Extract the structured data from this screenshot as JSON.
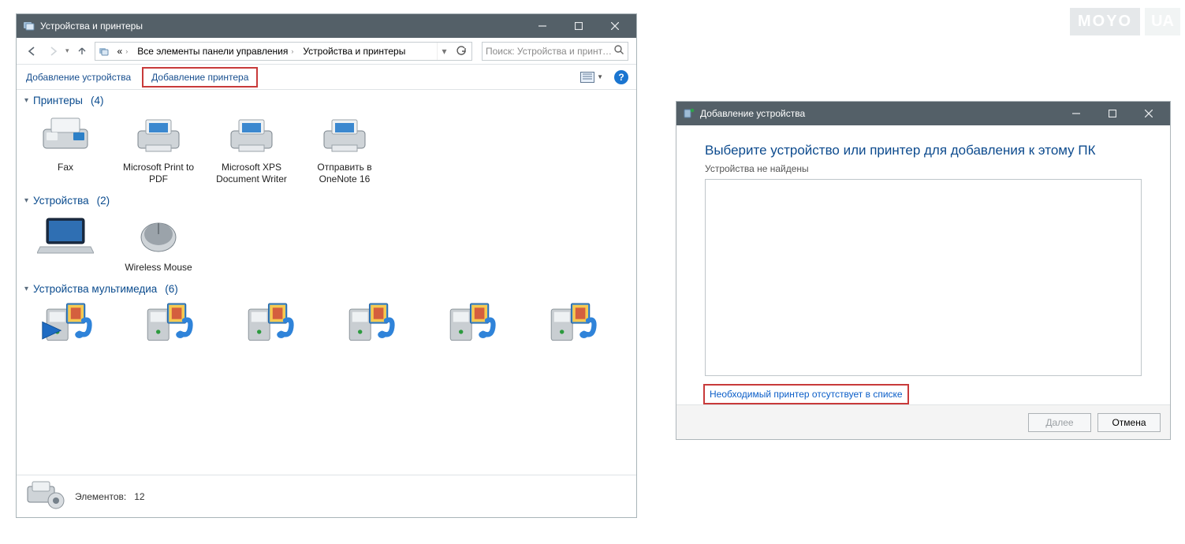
{
  "watermark": {
    "moyo": "MOYO",
    "ua": "UA"
  },
  "window": {
    "title": "Устройства и принтеры",
    "breadcrumb": {
      "ellipsis": "«",
      "seg1": "Все элементы панели управления",
      "seg2": "Устройства и принтеры"
    },
    "search_placeholder": "Поиск: Устройства и принте...",
    "commands": {
      "add_device": "Добавление устройства",
      "add_printer": "Добавление принтера"
    },
    "groups": {
      "printers": {
        "title": "Принтеры",
        "count": "(4)"
      },
      "devices": {
        "title": "Устройства",
        "count": "(2)"
      },
      "multimedia": {
        "title": "Устройства мультимедиа",
        "count": "(6)"
      }
    },
    "printers": [
      {
        "label": "Fax"
      },
      {
        "label": "Microsoft Print to PDF"
      },
      {
        "label": "Microsoft XPS Document Writer"
      },
      {
        "label": "Отправить в OneNote 16"
      }
    ],
    "devices": [
      {
        "label": ""
      },
      {
        "label": "Wireless Mouse"
      }
    ],
    "multimedia_count": 6,
    "status": {
      "elements_label": "Элементов:",
      "elements_value": "12"
    }
  },
  "dialog": {
    "title": "Добавление устройства",
    "heading": "Выберите устройство или принтер для добавления к этому ПК",
    "subtext": "Устройства не найдены",
    "link": "Необходимый принтер отсутствует в списке",
    "buttons": {
      "next": "Далее",
      "cancel": "Отмена"
    }
  }
}
